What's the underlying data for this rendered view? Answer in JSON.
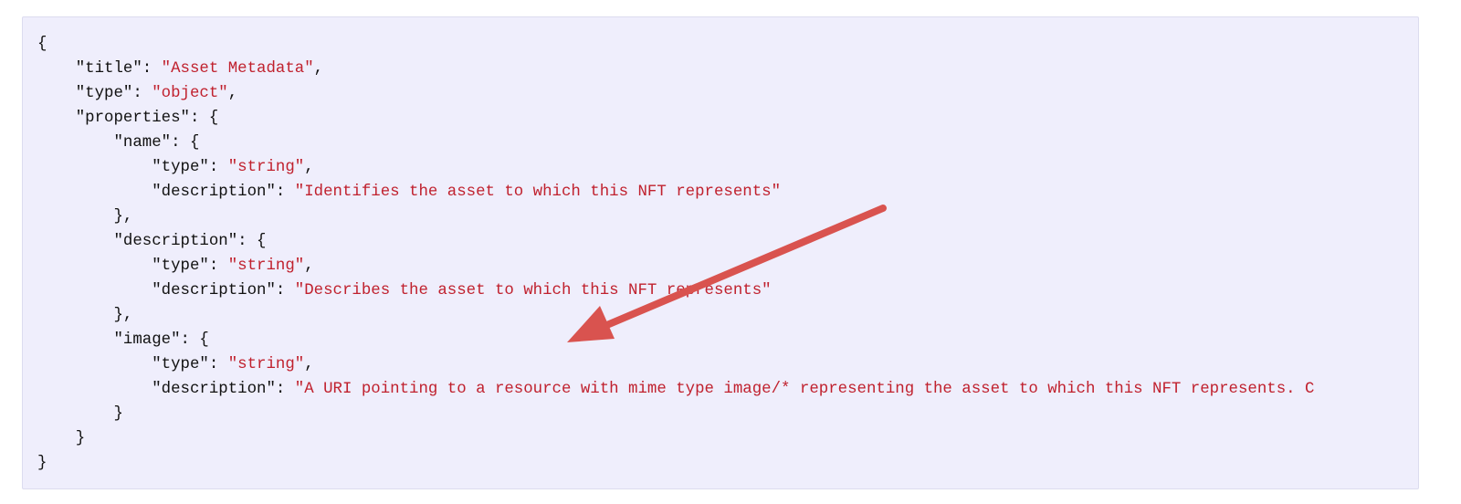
{
  "code_lines": [
    {
      "text": "{",
      "value": ""
    },
    {
      "text": "    \"title\": ",
      "value": "\"Asset Metadata\"",
      "suffix": ","
    },
    {
      "text": "    \"type\": ",
      "value": "\"object\"",
      "suffix": ","
    },
    {
      "text": "    \"properties\": {",
      "value": ""
    },
    {
      "text": "        \"name\": {",
      "value": ""
    },
    {
      "text": "            \"type\": ",
      "value": "\"string\"",
      "suffix": ","
    },
    {
      "text": "            \"description\": ",
      "value": "\"Identifies the asset to which this NFT represents\"",
      "suffix": ""
    },
    {
      "text": "        },",
      "value": ""
    },
    {
      "text": "        \"description\": {",
      "value": ""
    },
    {
      "text": "            \"type\": ",
      "value": "\"string\"",
      "suffix": ","
    },
    {
      "text": "            \"description\": ",
      "value": "\"Describes the asset to which this NFT represents\"",
      "suffix": ""
    },
    {
      "text": "        },",
      "value": ""
    },
    {
      "text": "        \"image\": {",
      "value": ""
    },
    {
      "text": "            \"type\": ",
      "value": "\"string\"",
      "suffix": ","
    },
    {
      "text": "            \"description\": ",
      "value": "\"A URI pointing to a resource with mime type image/* representing the asset to which this NFT represents. C",
      "suffix": ""
    },
    {
      "text": "        }",
      "value": ""
    },
    {
      "text": "    }",
      "value": ""
    },
    {
      "text": "}",
      "value": ""
    }
  ],
  "colors": {
    "string": "#c0212e",
    "background": "#efeefc",
    "arrow": "#d9534f"
  },
  "annotation": {
    "icon": "arrow-annotation-icon"
  }
}
